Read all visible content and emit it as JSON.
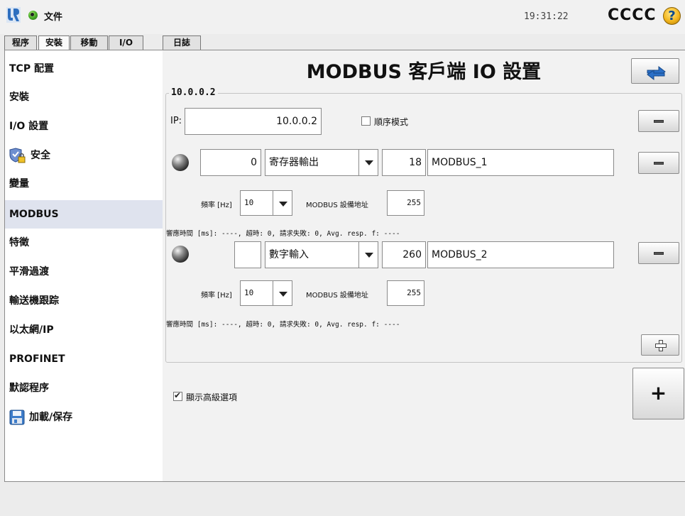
{
  "topbar": {
    "file_menu": "文件",
    "clock": "19:31:22",
    "robot_name": "CCCC",
    "help": "?"
  },
  "tabs": [
    {
      "label": "程序"
    },
    {
      "label": "安裝"
    },
    {
      "label": "移動"
    },
    {
      "label": "I/O"
    },
    {
      "label": "日誌"
    }
  ],
  "sidebar": {
    "items": [
      {
        "label": "TCP 配置"
      },
      {
        "label": "安裝"
      },
      {
        "label": "I/O 設置"
      },
      {
        "label": "安全"
      },
      {
        "label": "變量"
      },
      {
        "label": "MODBUS"
      },
      {
        "label": "特徵"
      },
      {
        "label": "平滑過渡"
      },
      {
        "label": "輸送機跟踪"
      },
      {
        "label": "以太網/IP"
      },
      {
        "label": "PROFINET"
      },
      {
        "label": "默認程序"
      },
      {
        "label": "加載/保存"
      }
    ]
  },
  "main": {
    "title": "MODBUS 客戶端 IO 設置",
    "group": {
      "legend": "10.0.0.2",
      "ip_label": "IP:",
      "ip_value": "10.0.0.2",
      "sequential_label": "順序模式",
      "signals": [
        {
          "address": "0",
          "type": "寄存器輸出",
          "register": "18",
          "name": "MODBUS_1",
          "freq_label": "頻率 [Hz]",
          "freq_value": "10",
          "slave_label": "MODBUS 設備地址",
          "slave_value": "255",
          "status": "響應時間 [ms]: ----, 超時: 0, 請求失敗: 0, Avg. resp. f: ----"
        },
        {
          "address": "",
          "type": "數字輸入",
          "register": "260",
          "name": "MODBUS_2",
          "freq_label": "頻率 [Hz]",
          "freq_value": "10",
          "slave_label": "MODBUS 設備地址",
          "slave_value": "255",
          "status": "響應時間 [ms]: ----, 超時: 0, 請求失敗: 0, Avg. resp. f: ----"
        }
      ]
    },
    "advanced_label": "顯示高級選項",
    "big_add": "+"
  }
}
